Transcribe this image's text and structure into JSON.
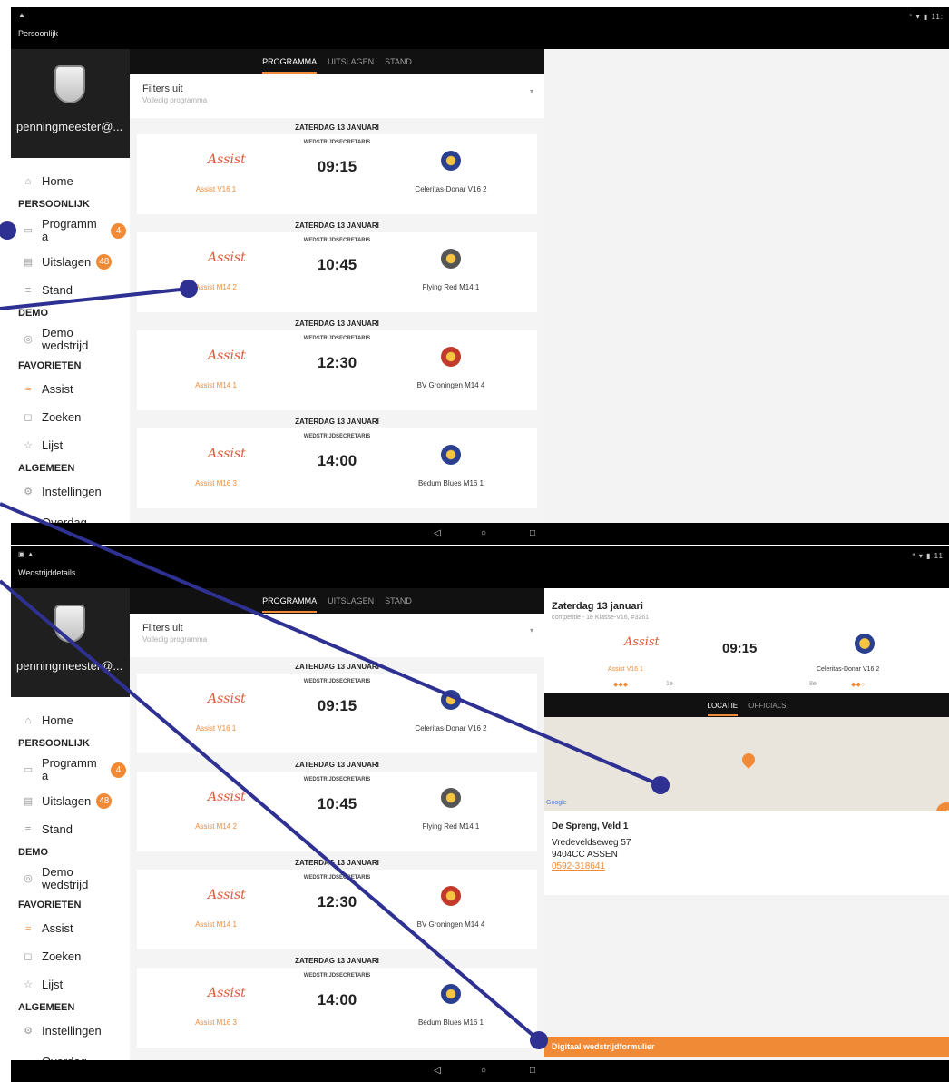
{
  "top_screen": {
    "status": {
      "app_title": "Persoonlijk",
      "sys_icons": "* ▾ ▮ 11:",
      "corner": "▲"
    },
    "drawer": {
      "email": "penningmeester@...",
      "items": [
        {
          "type": "item",
          "icon": "home-icon",
          "glyph": "⌂",
          "label": "Home"
        },
        {
          "type": "section",
          "label": "PERSOONLIJK"
        },
        {
          "type": "item",
          "icon": "calendar-icon",
          "glyph": "▭",
          "label": "Programm a",
          "badge": "4"
        },
        {
          "type": "item",
          "icon": "list-icon",
          "glyph": "▤",
          "label": "Uitslagen",
          "badge": "48"
        },
        {
          "type": "item",
          "icon": "standings-icon",
          "glyph": "≡",
          "label": "Stand"
        },
        {
          "type": "section",
          "label": "DEMO"
        },
        {
          "type": "item",
          "icon": "demo-icon",
          "glyph": "◎",
          "label": "Demo wedstrijd"
        },
        {
          "type": "section",
          "label": "FAVORIETEN"
        },
        {
          "type": "item",
          "icon": "club-logo-icon",
          "glyph": "≈",
          "label": "Assist",
          "orange": true
        },
        {
          "type": "item",
          "icon": "search-icon",
          "glyph": "◻",
          "label": "Zoeken"
        },
        {
          "type": "item",
          "icon": "star-icon",
          "glyph": "☆",
          "label": "Lijst"
        },
        {
          "type": "section",
          "label": "ALGEMEEN"
        },
        {
          "type": "item",
          "icon": "settings-icon",
          "glyph": "⚙",
          "label": "Instellingen"
        },
        {
          "type": "item",
          "icon": "more-icon",
          "glyph": "",
          "label": "Overdag..."
        }
      ]
    },
    "tabs": [
      "PROGRAMMA",
      "UITSLAGEN",
      "STAND"
    ],
    "filter": {
      "title": "Filters uit",
      "subtitle": "Volledig programma",
      "caret": "▾"
    },
    "matches": [
      {
        "date": "ZATERDAG 13 JANUARI",
        "role": "WEDSTRIJDSECRETARIS",
        "time": "09:15",
        "home": "Assist V16 1",
        "away": "Celeritas-Donar V16 2",
        "away_color": "#2a3f8f"
      },
      {
        "date": "ZATERDAG 13 JANUARI",
        "role": "WEDSTRIJDSECRETARIS",
        "time": "10:45",
        "home": "Assist M14 2",
        "away": "Flying Red M14 1",
        "away_color": "#555555"
      },
      {
        "date": "ZATERDAG 13 JANUARI",
        "role": "WEDSTRIJDSECRETARIS",
        "time": "12:30",
        "home": "Assist M14 1",
        "away": "BV Groningen M14 4",
        "away_color": "#c0392b"
      },
      {
        "date": "ZATERDAG 13 JANUARI",
        "role": "WEDSTRIJDSECRETARIS",
        "time": "14:00",
        "home": "Assist M16 3",
        "away": "Bedum Blues M16 1",
        "away_color": "#2a3f8f"
      }
    ],
    "home_logo_text": "Assist",
    "navbar": {
      "back": "◁",
      "home": "○",
      "recent": "□"
    }
  },
  "bottom_screen": {
    "status": {
      "app_title": "Wedstrijddetails",
      "sys_icons": "* ▾ ▮ 11",
      "corner": "▣ ▲"
    },
    "detail": {
      "date": "Zaterdag 13 januari",
      "subtitle": "competitie - 1e Klasse-V16, #3261",
      "time": "09:15",
      "home": "Assist V16 1",
      "away": "Celeritas-Donar V16 2",
      "home_form": "◆◆◆",
      "home_rank": "1e",
      "away_rank": "8e",
      "away_form": "◆◆○",
      "tabs": [
        "LOCATIE",
        "OFFICIALS"
      ],
      "map_label": "Google",
      "directions_icon": "➜",
      "venue": "De Spreng, Veld 1",
      "street": "Vredeveldseweg 57",
      "city": "9404CC ASSEN",
      "phone": "0592-318641",
      "cta": "Digitaal wedstrijdformulier"
    }
  },
  "colors": {
    "accent": "#f08a36",
    "callout": "#2e3192",
    "dark": "#111111"
  }
}
